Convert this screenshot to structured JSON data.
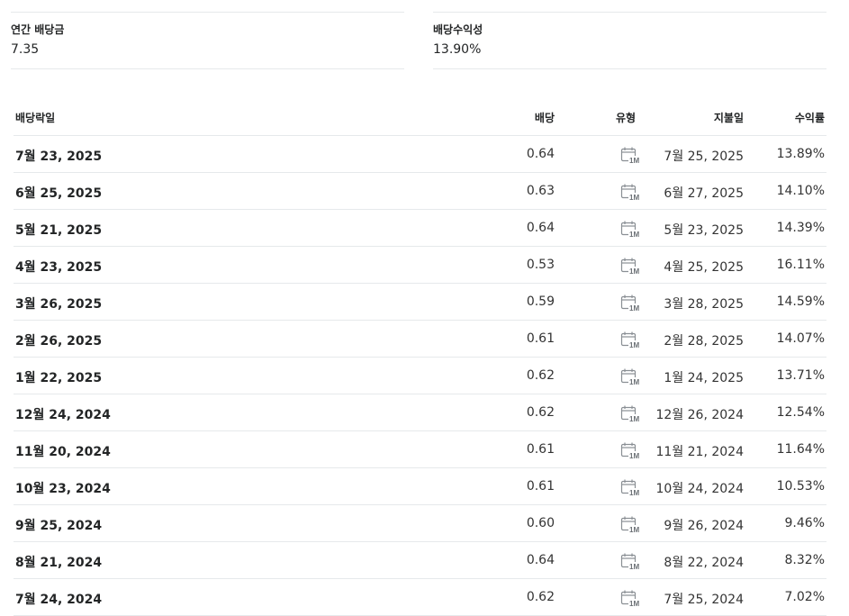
{
  "summary": {
    "annual_dividend_label": "연간 배당금",
    "annual_dividend_value": "7.35",
    "dividend_yield_label": "배당수익성",
    "dividend_yield_value": "13.90%"
  },
  "table": {
    "headers": {
      "ex_date": "배당락일",
      "dividend": "배당",
      "type": "유형",
      "pay_date": "지불일",
      "yield": "수익률"
    },
    "type_icon": "monthly-calendar-icon",
    "type_icon_text": "1M",
    "rows": [
      {
        "ex_date": "7월 23, 2025",
        "dividend": "0.64",
        "pay_date": "7월 25, 2025",
        "yield": "13.89%"
      },
      {
        "ex_date": "6월 25, 2025",
        "dividend": "0.63",
        "pay_date": "6월 27, 2025",
        "yield": "14.10%"
      },
      {
        "ex_date": "5월 21, 2025",
        "dividend": "0.64",
        "pay_date": "5월 23, 2025",
        "yield": "14.39%"
      },
      {
        "ex_date": "4월 23, 2025",
        "dividend": "0.53",
        "pay_date": "4월 25, 2025",
        "yield": "16.11%"
      },
      {
        "ex_date": "3월 26, 2025",
        "dividend": "0.59",
        "pay_date": "3월 28, 2025",
        "yield": "14.59%"
      },
      {
        "ex_date": "2월 26, 2025",
        "dividend": "0.61",
        "pay_date": "2월 28, 2025",
        "yield": "14.07%"
      },
      {
        "ex_date": "1월 22, 2025",
        "dividend": "0.62",
        "pay_date": "1월 24, 2025",
        "yield": "13.71%"
      },
      {
        "ex_date": "12월 24, 2024",
        "dividend": "0.62",
        "pay_date": "12월 26, 2024",
        "yield": "12.54%"
      },
      {
        "ex_date": "11월 20, 2024",
        "dividend": "0.61",
        "pay_date": "11월 21, 2024",
        "yield": "11.64%"
      },
      {
        "ex_date": "10월 23, 2024",
        "dividend": "0.61",
        "pay_date": "10월 24, 2024",
        "yield": "10.53%"
      },
      {
        "ex_date": "9월 25, 2024",
        "dividend": "0.60",
        "pay_date": "9월 26, 2024",
        "yield": "9.46%"
      },
      {
        "ex_date": "8월 21, 2024",
        "dividend": "0.64",
        "pay_date": "8월 22, 2024",
        "yield": "8.32%"
      },
      {
        "ex_date": "7월 24, 2024",
        "dividend": "0.62",
        "pay_date": "7월 25, 2024",
        "yield": "7.02%"
      }
    ]
  }
}
